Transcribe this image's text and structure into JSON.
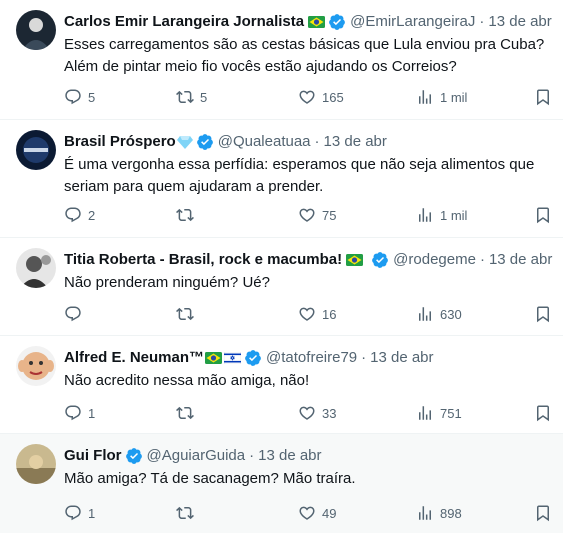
{
  "tweets": [
    {
      "name": "Carlos Emir Larangeira Jornalista",
      "handle": "@EmirLarangeiraJ",
      "date": "13 de abr",
      "flags": [
        "br"
      ],
      "text": "Esses carregamentos são as cestas básicas que Lula enviou pra Cuba? Além de pintar meio fio vocês estão ajudando os Correios?",
      "replies": "5",
      "retweets": "5",
      "likes": "165",
      "views": "1 mil"
    },
    {
      "name": "Brasil Próspero",
      "handle": "@Qualeatuaa",
      "date": "13 de abr",
      "flags": [
        "diamond"
      ],
      "text": "É uma vergonha essa perfídia: esperamos que não seja alimentos que seriam para quem ajudaram a prender.",
      "replies": "2",
      "retweets": "",
      "likes": "75",
      "views": "1 mil"
    },
    {
      "name": "Titia Roberta - Brasil, rock e macumba!",
      "handle": "@rodegeme",
      "date": "13 de abr",
      "flags": [
        "br"
      ],
      "text": "Não prenderam ninguém? Ué?",
      "replies": "",
      "retweets": "",
      "likes": "16",
      "views": "630"
    },
    {
      "name": "Alfred E. Neuman™",
      "handle": "@tatofreire79",
      "date": "13 de abr",
      "flags": [
        "br",
        "il"
      ],
      "text": "Não acredito nessa mão amiga, não!",
      "replies": "1",
      "retweets": "",
      "likes": "33",
      "views": "751"
    },
    {
      "name": "Gui Flor",
      "handle": "@AguiarGuida",
      "date": "13 de abr",
      "flags": [],
      "text": "Mão amiga? Tá de sacanagem? Mão traíra.",
      "replies": "1",
      "retweets": "",
      "likes": "49",
      "views": "898"
    }
  ],
  "separator": "·",
  "colors": {
    "verified": "#1d9bf0",
    "muted": "#536471",
    "text": "#0f1419",
    "highlight_bg": "#f7f9f9"
  },
  "icons": {
    "reply": "reply-icon",
    "retweet": "retweet-icon",
    "like": "heart-icon",
    "views": "views-icon",
    "bookmark": "bookmark-icon",
    "verified": "verified-badge-icon"
  }
}
